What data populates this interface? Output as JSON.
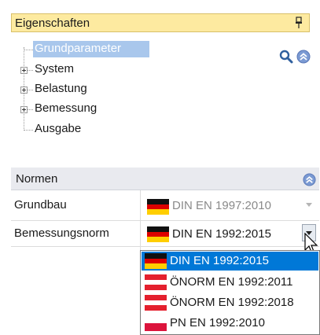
{
  "properties_panel": {
    "title": "Eigenschaften",
    "pin_icon": "pin-icon",
    "header_color": "#fdeaa0"
  },
  "tree": {
    "items": [
      {
        "label": "Grundparameter",
        "expandable": false,
        "selected": true
      },
      {
        "label": "System",
        "expandable": true
      },
      {
        "label": "Belastung",
        "expandable": true
      },
      {
        "label": "Bemessung",
        "expandable": true
      },
      {
        "label": "Ausgabe",
        "expandable": false
      }
    ],
    "tools": [
      "search-icon",
      "collapse-icon"
    ]
  },
  "normen": {
    "title": "Normen",
    "rows": [
      {
        "label": "Grundbau",
        "value": "DIN EN 1997:2010",
        "flag": "de",
        "disabled": true
      },
      {
        "label": "Bemessungsnorm",
        "value": "DIN EN 1992:2015",
        "flag": "de",
        "dropdown_open": true
      }
    ],
    "dropdown_options": [
      {
        "label": "DIN EN 1992:2015",
        "flag": "de",
        "selected": true
      },
      {
        "label": "ÖNORM EN 1992:2011",
        "flag": "at"
      },
      {
        "label": "ÖNORM EN 1992:2018",
        "flag": "at"
      },
      {
        "label": "PN EN 1992:2010",
        "flag": "pl"
      }
    ]
  },
  "colors": {
    "selection": "#0078d7",
    "tree_selection": "#a9c7ec",
    "section_header": "#e9eaef"
  }
}
